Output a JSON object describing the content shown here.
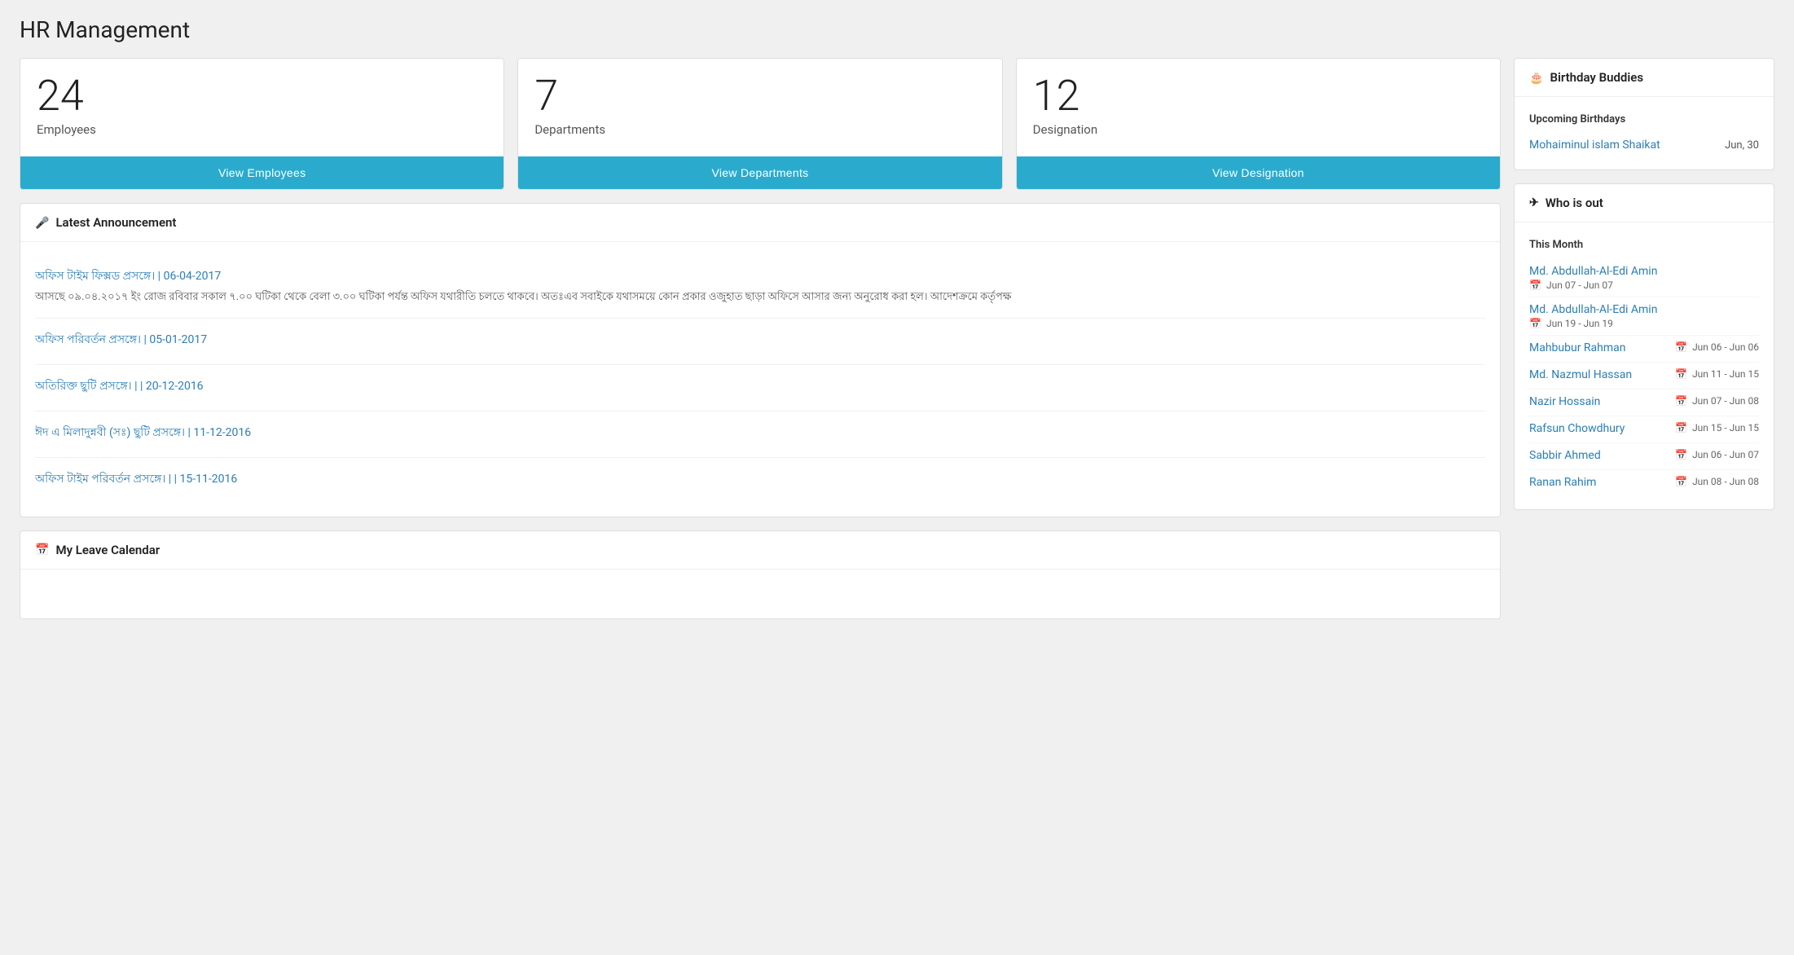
{
  "page": {
    "title": "HR Management"
  },
  "stats": [
    {
      "id": "employees",
      "number": "24",
      "label": "Employees",
      "button_label": "View Employees"
    },
    {
      "id": "departments",
      "number": "7",
      "label": "Departments",
      "button_label": "View Departments"
    },
    {
      "id": "designation",
      "number": "12",
      "label": "Designation",
      "button_label": "View Designation"
    }
  ],
  "announcement": {
    "header": "Latest Announcement",
    "items": [
      {
        "title": "অফিস টাইম ফিক্সড প্রসঙ্গে। | 06-04-2017",
        "excerpt": "আসছে ০৯.০৪.২০১৭ ইং রোজ রবিবার সকাল ৭.০০ ঘটিকা থেকে বেলা ৩.০০ ঘটিকা পর্যন্ত অফিস যথারীতি চলতে থাকবে। অতঃএব সবাইকে যথাসময়ে কোন প্রকার ওজুহাত ছাড়া অফিসে আসার জন্য অনুরোধ করা হল। আদেশক্রমে কর্তৃপক্ষ"
      },
      {
        "title": "অফিস পরিবর্তন প্রসঙ্গে। | 05-01-2017",
        "excerpt": ""
      },
      {
        "title": "অতিরিক্ত ছুটি প্রসঙ্গে। | | 20-12-2016",
        "excerpt": ""
      },
      {
        "title": "ঈদ এ মিলাদুন্নবী (সঃ) ছুটি প্রসঙ্গে। | 11-12-2016",
        "excerpt": ""
      },
      {
        "title": "অফিস টাইম পরিবর্তন প্রসঙ্গে। | | 15-11-2016",
        "excerpt": ""
      }
    ]
  },
  "leave_calendar": {
    "header": "My Leave Calendar",
    "icon": "calendar"
  },
  "birthday_buddies": {
    "header": "Birthday Buddies",
    "upcoming_label": "Upcoming Birthdays",
    "entries": [
      {
        "name": "Mohaiminul islam Shaikat",
        "date": "Jun, 30"
      }
    ]
  },
  "who_is_out": {
    "header": "Who is out",
    "month_label": "This Month",
    "entries": [
      {
        "name": "Md. Abdullah-Al-Edi Amin",
        "dates": "Jun 07 - Jun 07"
      },
      {
        "name": "Md. Abdullah-Al-Edi Amin",
        "dates": "Jun 19 - Jun 19"
      },
      {
        "name": "Mahbubur Rahman",
        "dates": "Jun 06 - Jun 06"
      },
      {
        "name": "Md. Nazmul Hassan",
        "dates": "Jun 11 - Jun 15"
      },
      {
        "name": "Nazir Hossain",
        "dates": "Jun 07 - Jun 08"
      },
      {
        "name": "Rafsun Chowdhury",
        "dates": "Jun 15 - Jun 15"
      },
      {
        "name": "Sabbir Ahmed",
        "dates": "Jun 06 - Jun 07"
      },
      {
        "name": "Ranan Rahim",
        "dates": "Jun 08 - Jun 08"
      }
    ]
  }
}
